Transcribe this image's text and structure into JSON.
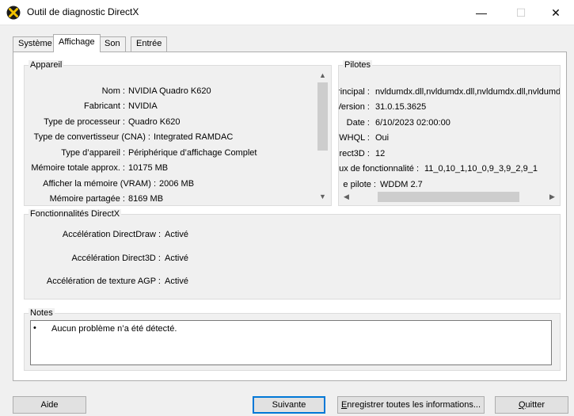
{
  "window": {
    "title": "Outil de diagnostic DirectX",
    "minimize_glyph": "—",
    "maximize_glyph": "☐",
    "close_glyph": "✕"
  },
  "tabs": [
    {
      "label": "Système"
    },
    {
      "label": "Affichage"
    },
    {
      "label": "Son"
    },
    {
      "label": "Entrée"
    }
  ],
  "device": {
    "title": "Appareil",
    "rows": [
      {
        "label": "Nom :",
        "value": "NVIDIA Quadro K620"
      },
      {
        "label": "Fabricant :",
        "value": "NVIDIA"
      },
      {
        "label": "Type de processeur :",
        "value": "Quadro K620"
      },
      {
        "label": "Type de convertisseur (CNA) :",
        "value": "Integrated RAMDAC"
      },
      {
        "label": "Type d’appareil :",
        "value": "Périphérique d’affichage Complet"
      },
      {
        "label": "Mémoire totale approx. :",
        "value": "10175 MB"
      },
      {
        "label": "Afficher la mémoire (VRAM) :",
        "value": "2006 MB"
      },
      {
        "label": "Mémoire partagée :",
        "value": "8169 MB"
      }
    ]
  },
  "drivers": {
    "title": "Pilotes",
    "rows": [
      {
        "label": "rincipal :",
        "value": "nvldumdx.dll,nvldumdx.dll,nvldumdx.dll,nvldumd"
      },
      {
        "label": "Version :",
        "value": "31.0.15.3625"
      },
      {
        "label": "Date :",
        "value": "6/10/2023 02:00:00"
      },
      {
        "label": "WHQL :",
        "value": "Oui"
      },
      {
        "label": "irect3D :",
        "value": "12"
      },
      {
        "label": "ux de fonctionnalité :",
        "value": "11_0,10_1,10_0,9_3,9_2,9_1"
      },
      {
        "label": "e pilote :",
        "value": "WDDM 2.7"
      }
    ]
  },
  "features": {
    "title": "Fonctionnalités DirectX",
    "rows": [
      {
        "label": "Accélération DirectDraw :",
        "value": "Activé"
      },
      {
        "label": "Accélération Direct3D :",
        "value": "Activé"
      },
      {
        "label": "Accélération de texture AGP :",
        "value": "Activé"
      }
    ]
  },
  "notes": {
    "title": "Notes",
    "bullet": "•",
    "items": [
      "Aucun problème n’a été détecté."
    ]
  },
  "buttons": {
    "help": "Aide",
    "next": "Suivante",
    "save_prefix": "",
    "save_ul": "E",
    "save_rest": "nregistrer toutes les informations...",
    "quit_prefix": "",
    "quit_ul": "Q",
    "quit_rest": "uitter"
  },
  "scroll_glyphs": {
    "up": "▲",
    "down": "▼",
    "left": "◀",
    "right": "▶"
  },
  "scroll_state": {
    "device_vertical_fraction": 0.0,
    "drivers_horizontal_fraction": 0.0
  },
  "colors": {
    "accent": "#0078d7",
    "panel": "#f0f0f0",
    "border": "#adadad"
  }
}
